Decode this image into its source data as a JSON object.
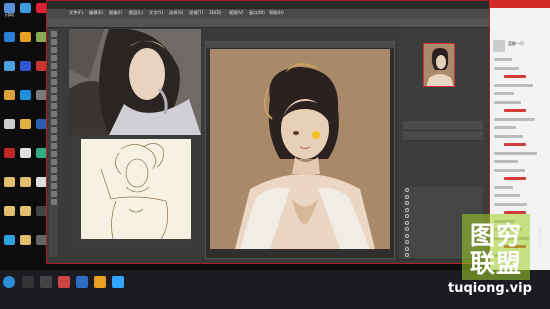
{
  "desktop": {
    "icons": [
      {
        "label": "计算机",
        "color": "#5a8fd8"
      },
      {
        "label": "",
        "color": "#3a9de0"
      },
      {
        "label": "",
        "color": "#d23"
      },
      {
        "label": "",
        "color": "#2a7fd4"
      },
      {
        "label": "",
        "color": "#e8a020"
      },
      {
        "label": "",
        "color": "#8a5"
      },
      {
        "label": "",
        "color": "#4aa3e0"
      },
      {
        "label": "",
        "color": "#35c"
      },
      {
        "label": "",
        "color": "#c33"
      },
      {
        "label": "",
        "color": "#d9a33a"
      },
      {
        "label": "",
        "color": "#1d8fdc"
      },
      {
        "label": "",
        "color": "#7a7a7a"
      },
      {
        "label": "",
        "color": "#ccc"
      },
      {
        "label": "",
        "color": "#e0b040"
      },
      {
        "label": "",
        "color": "#2b5fb0"
      },
      {
        "label": "",
        "color": "#c02828"
      },
      {
        "label": "",
        "color": "#e0e0e0"
      },
      {
        "label": "",
        "color": "#3a8"
      },
      {
        "label": "",
        "color": "#e0c070"
      },
      {
        "label": "",
        "color": "#e0c070"
      },
      {
        "label": "",
        "color": "#ddd"
      },
      {
        "label": "",
        "color": "#e0c070"
      },
      {
        "label": "",
        "color": "#e0c070"
      },
      {
        "label": "",
        "color": "#444"
      },
      {
        "label": "",
        "color": "#2fa0e0"
      },
      {
        "label": "",
        "color": "#e0c070"
      },
      {
        "label": "",
        "color": "#666"
      }
    ]
  },
  "photoshop": {
    "title": "",
    "menu": [
      "文件(F)",
      "编辑(E)",
      "图像(I)",
      "图层(L)",
      "文字(Y)",
      "选择(S)",
      "滤镜(T)",
      "3D(D)",
      "视图(V)",
      "窗口(W)",
      "帮助(H)"
    ],
    "sketch_status": "",
    "layers": [
      "",
      "",
      "",
      "",
      "",
      "",
      "",
      "",
      "",
      "",
      ""
    ]
  },
  "chat": {
    "header": "",
    "username": "蓝鲸一只"
  },
  "watermark": {
    "line1": "图穷",
    "line2": "联盟",
    "side": "SNUCON",
    "url": "tuqiong.vip"
  },
  "colors": {
    "accent_red": "#d62b2b",
    "canvas_bg": "#a88a6a",
    "watermark_green": "#a0d228"
  }
}
